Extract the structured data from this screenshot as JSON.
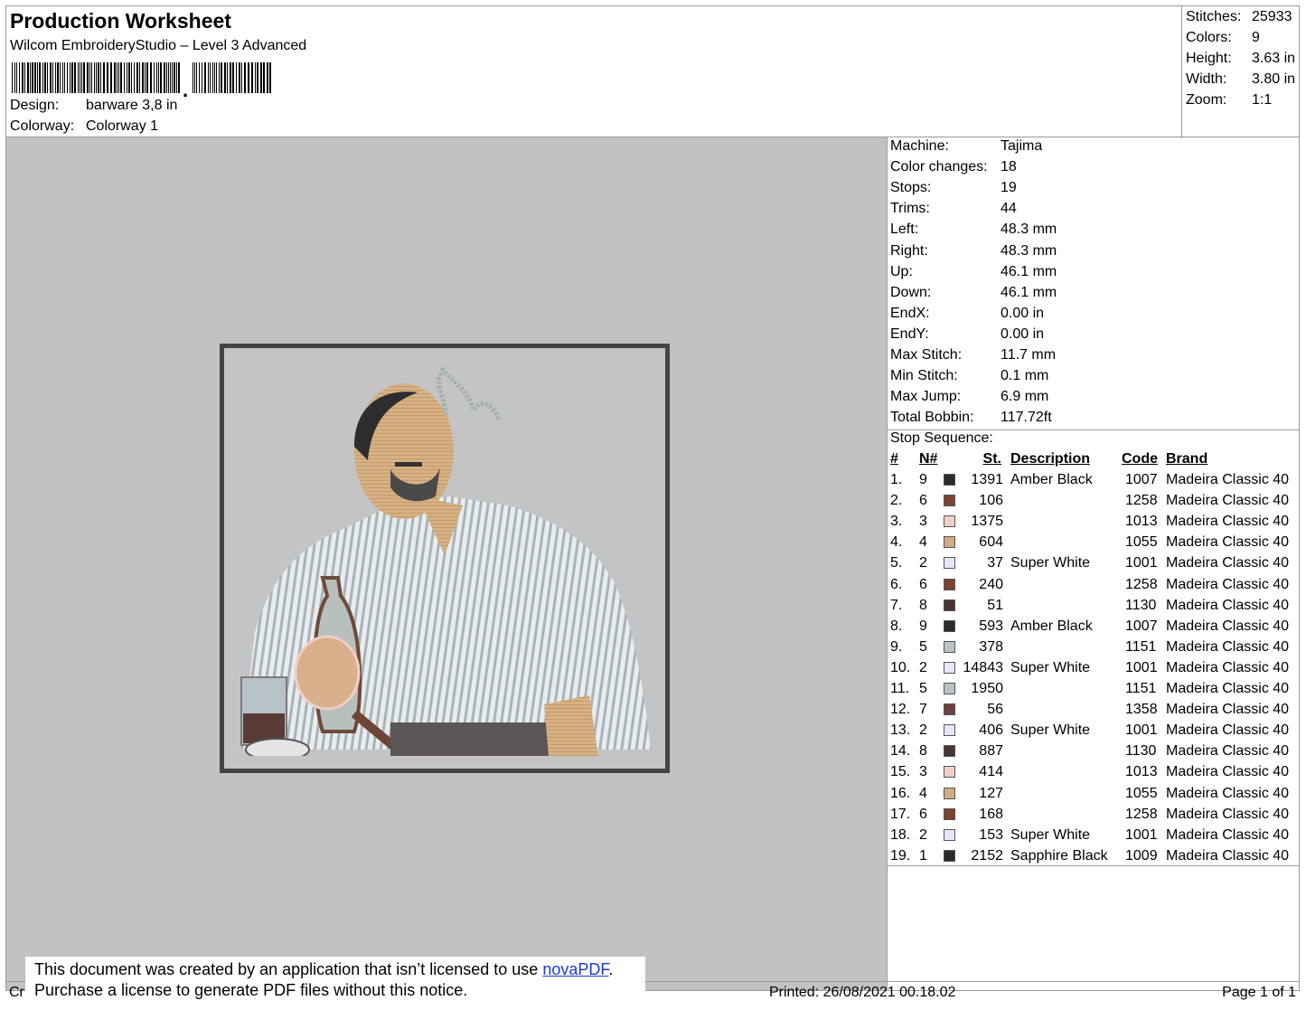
{
  "header": {
    "title": "Production Worksheet",
    "subtitle": "Wilcom EmbroideryStudio – Level 3 Advanced",
    "design_label": "Design:",
    "design_value": "barware 3,8 in",
    "colorway_label": "Colorway:",
    "colorway_value": "Colorway 1"
  },
  "stats": [
    {
      "label": "Stitches:",
      "value": "25933"
    },
    {
      "label": "Colors:",
      "value": "9"
    },
    {
      "label": "Height:",
      "value": "3.63 in"
    },
    {
      "label": "Width:",
      "value": "3.80 in"
    },
    {
      "label": "Zoom:",
      "value": "1:1"
    }
  ],
  "machine_info": [
    {
      "label": "Machine:",
      "value": "Tajima"
    },
    {
      "label": "Color changes:",
      "value": "18"
    },
    {
      "label": "Stops:",
      "value": "19"
    },
    {
      "label": "Trims:",
      "value": "44"
    },
    {
      "label": "Left:",
      "value": "48.3 mm"
    },
    {
      "label": "Right:",
      "value": "48.3 mm"
    },
    {
      "label": "Up:",
      "value": "46.1 mm"
    },
    {
      "label": "Down:",
      "value": "46.1 mm"
    },
    {
      "label": "EndX:",
      "value": "0.00 in"
    },
    {
      "label": "EndY:",
      "value": "0.00 in"
    },
    {
      "label": "Max Stitch:",
      "value": "11.7 mm"
    },
    {
      "label": "Min Stitch:",
      "value": "0.1 mm"
    },
    {
      "label": "Max Jump:",
      "value": "6.9 mm"
    },
    {
      "label": "Total Bobbin:",
      "value": "117.72ft"
    }
  ],
  "stop_sequence": {
    "label": "Stop Sequence:",
    "headers": {
      "num": "#",
      "needle": "N#",
      "stitches": "St.",
      "description": "Description",
      "code": "Code",
      "brand": "Brand"
    },
    "rows": [
      {
        "num": "1.",
        "needle": "9",
        "color": "#2a2a2a",
        "stitches": "1391",
        "description": "Amber Black",
        "code": "1007",
        "brand": "Madeira Classic 40"
      },
      {
        "num": "2.",
        "needle": "6",
        "color": "#7a4530",
        "stitches": "106",
        "description": "",
        "code": "1258",
        "brand": "Madeira Classic 40"
      },
      {
        "num": "3.",
        "needle": "3",
        "color": "#f2cfc4",
        "stitches": "1375",
        "description": "",
        "code": "1013",
        "brand": "Madeira Classic 40"
      },
      {
        "num": "4.",
        "needle": "4",
        "color": "#d4ab84",
        "stitches": "604",
        "description": "",
        "code": "1055",
        "brand": "Madeira Classic 40"
      },
      {
        "num": "5.",
        "needle": "2",
        "color": "#e6e8fa",
        "stitches": "37",
        "description": "Super White",
        "code": "1001",
        "brand": "Madeira Classic 40"
      },
      {
        "num": "6.",
        "needle": "6",
        "color": "#7a4530",
        "stitches": "240",
        "description": "",
        "code": "1258",
        "brand": "Madeira Classic 40"
      },
      {
        "num": "7.",
        "needle": "8",
        "color": "#4a3434",
        "stitches": "51",
        "description": "",
        "code": "1130",
        "brand": "Madeira Classic 40"
      },
      {
        "num": "8.",
        "needle": "9",
        "color": "#2a2a2a",
        "stitches": "593",
        "description": "Amber Black",
        "code": "1007",
        "brand": "Madeira Classic 40"
      },
      {
        "num": "9.",
        "needle": "5",
        "color": "#b8c2c8",
        "stitches": "378",
        "description": "",
        "code": "1151",
        "brand": "Madeira Classic 40"
      },
      {
        "num": "10.",
        "needle": "2",
        "color": "#e6e8fa",
        "stitches": "14843",
        "description": "Super White",
        "code": "1001",
        "brand": "Madeira Classic 40"
      },
      {
        "num": "11.",
        "needle": "5",
        "color": "#b8c2c8",
        "stitches": "1950",
        "description": "",
        "code": "1151",
        "brand": "Madeira Classic 40"
      },
      {
        "num": "12.",
        "needle": "7",
        "color": "#6e4040",
        "stitches": "56",
        "description": "",
        "code": "1358",
        "brand": "Madeira Classic 40"
      },
      {
        "num": "13.",
        "needle": "2",
        "color": "#e6e8fa",
        "stitches": "406",
        "description": "Super White",
        "code": "1001",
        "brand": "Madeira Classic 40"
      },
      {
        "num": "14.",
        "needle": "8",
        "color": "#4a3434",
        "stitches": "887",
        "description": "",
        "code": "1130",
        "brand": "Madeira Classic 40"
      },
      {
        "num": "15.",
        "needle": "3",
        "color": "#f2cfc4",
        "stitches": "414",
        "description": "",
        "code": "1013",
        "brand": "Madeira Classic 40"
      },
      {
        "num": "16.",
        "needle": "4",
        "color": "#d4ab84",
        "stitches": "127",
        "description": "",
        "code": "1055",
        "brand": "Madeira Classic 40"
      },
      {
        "num": "17.",
        "needle": "6",
        "color": "#7a4530",
        "stitches": "168",
        "description": "",
        "code": "1258",
        "brand": "Madeira Classic 40"
      },
      {
        "num": "18.",
        "needle": "2",
        "color": "#e6e8fa",
        "stitches": "153",
        "description": "Super White",
        "code": "1001",
        "brand": "Madeira Classic 40"
      },
      {
        "num": "19.",
        "needle": "1",
        "color": "#2a2a2a",
        "stitches": "2152",
        "description": "Sapphire Black",
        "code": "1009",
        "brand": "Madeira Classic 40"
      }
    ]
  },
  "footer": {
    "created_prefix": "Cr",
    "printed": "Printed: 26/08/2021 00.18.02",
    "page": "Page 1 of 1"
  },
  "notice": {
    "line1_prefix": "This document was created by an application that isn’t licensed to use ",
    "link": "novaPDF",
    "line1_suffix": ".",
    "line2": "Purchase a license to generate PDF files without this notice."
  },
  "colors": {
    "canvas_bg": "#c2c2c2",
    "hoop_border": "#444444",
    "link": "#1a3ad6"
  }
}
